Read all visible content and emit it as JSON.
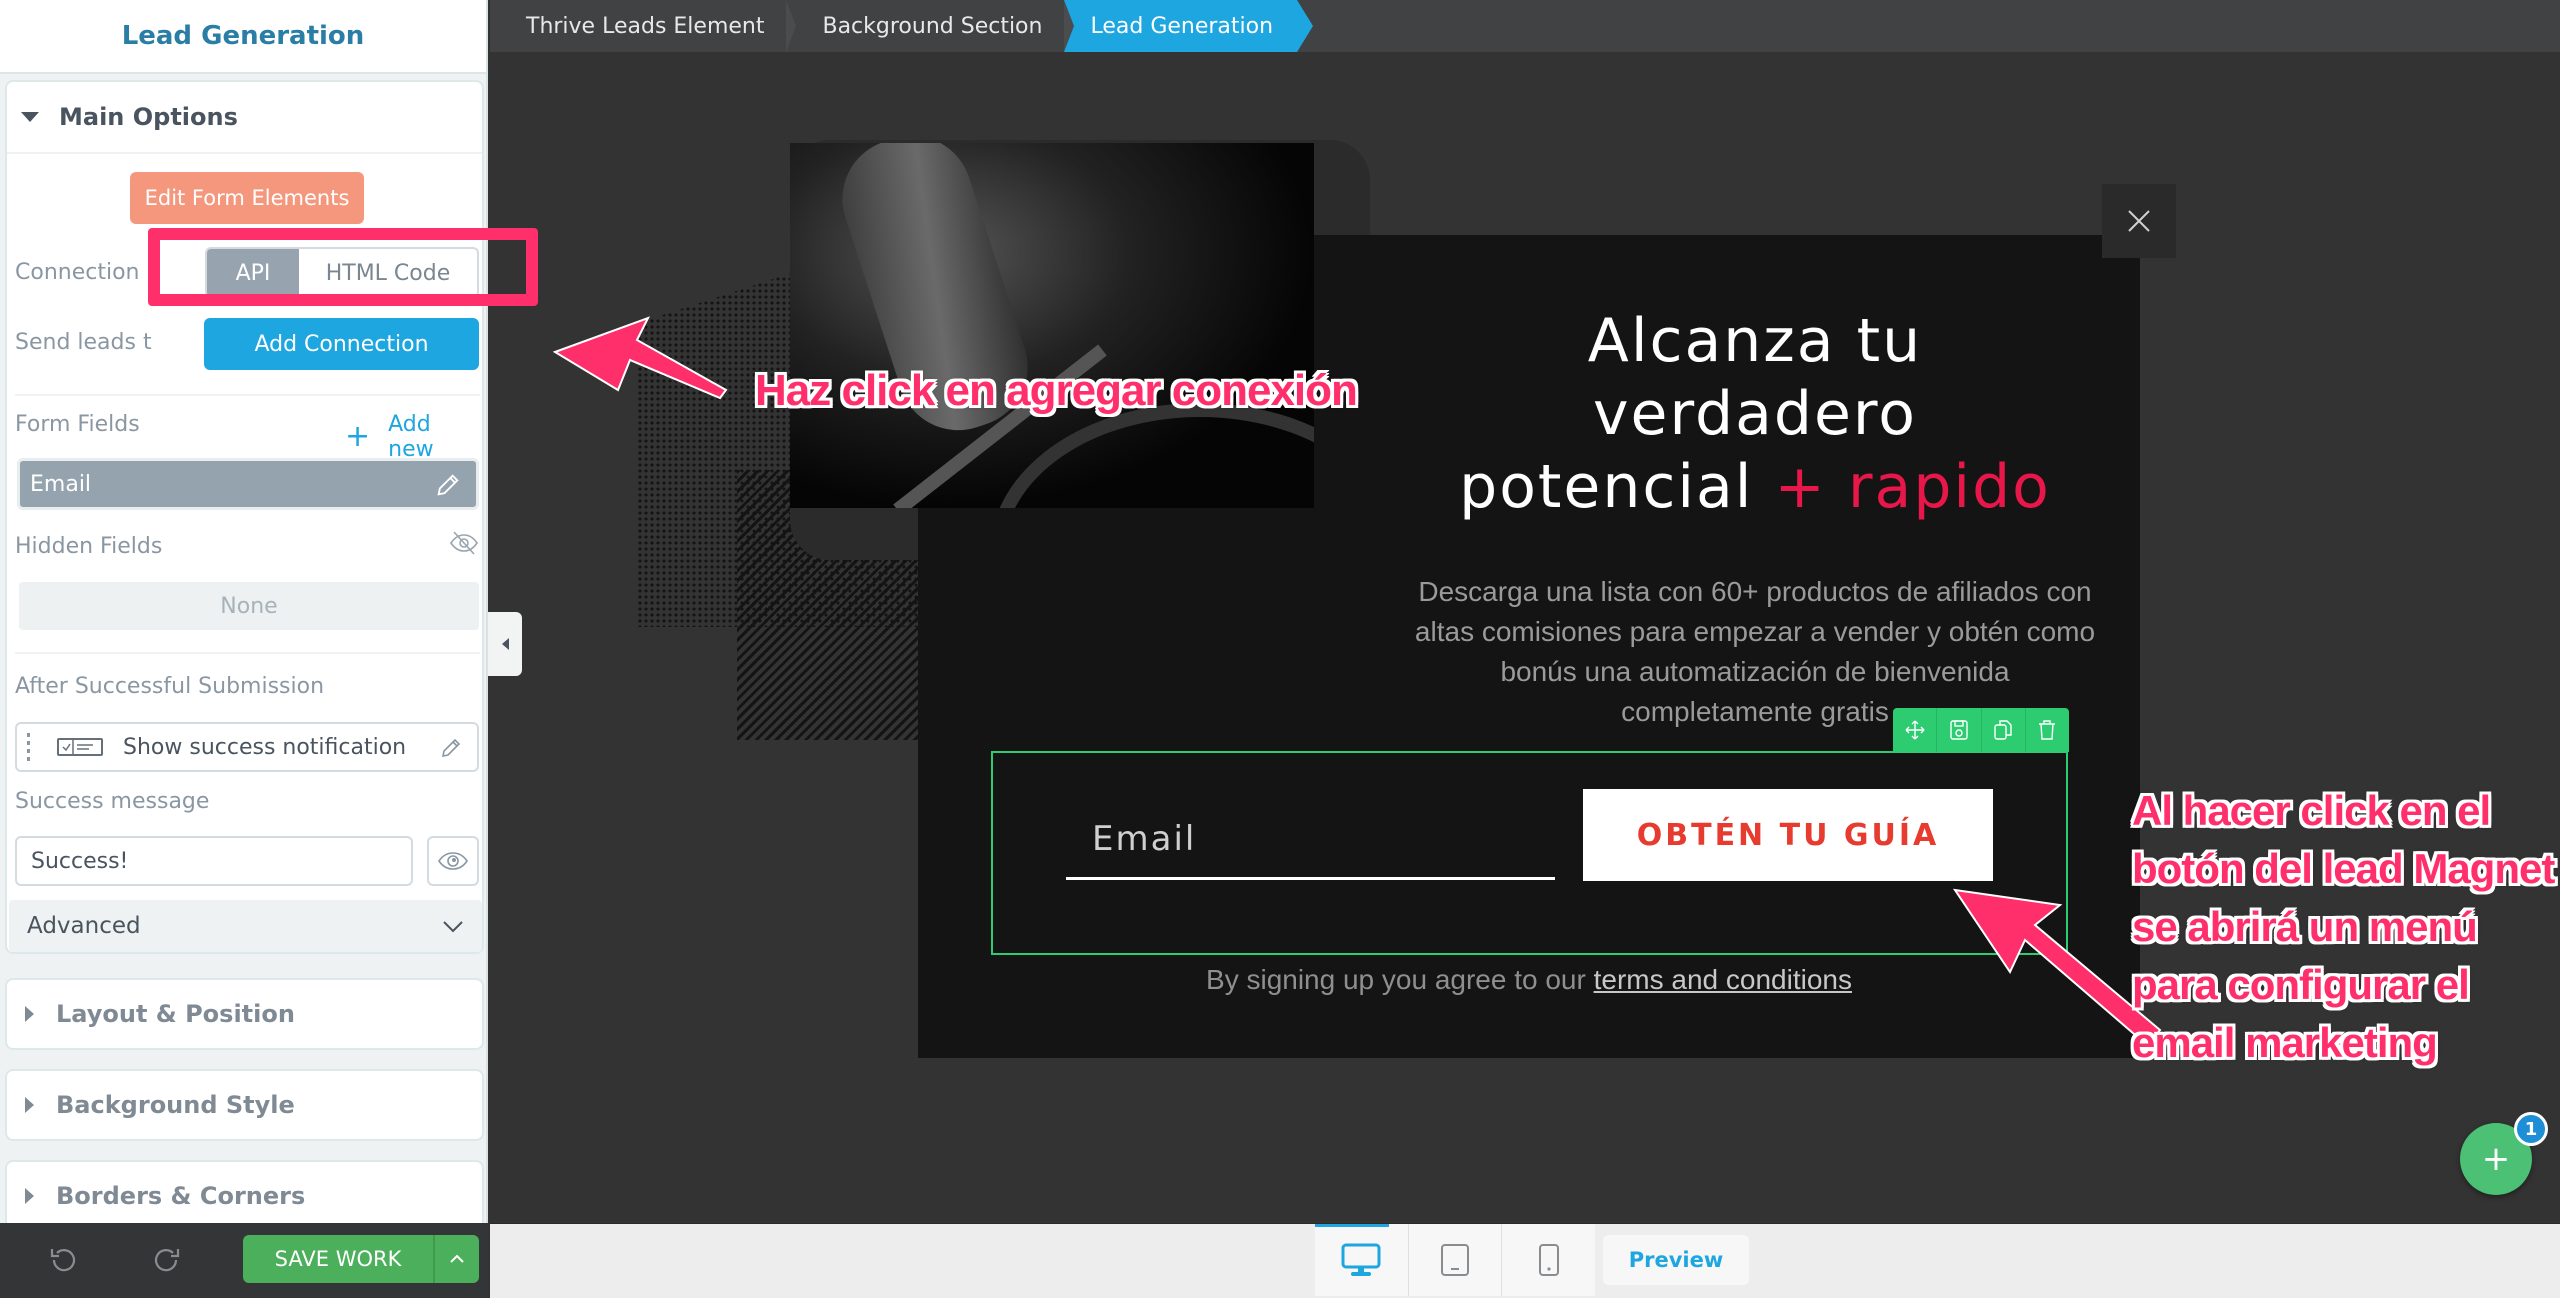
{
  "sidebar": {
    "title": "Lead Generation",
    "main_options": {
      "header": "Main Options",
      "edit_form_button": "Edit Form Elements",
      "connection_label": "Connection",
      "connection_options": [
        "API",
        "HTML Code"
      ],
      "connection_selected": "API",
      "send_leads_label": "Send leads t",
      "add_connection_button": "Add Connection",
      "form_fields_label": "Form Fields",
      "add_new_label": "Add new",
      "form_fields": [
        "Email"
      ],
      "hidden_fields_label": "Hidden Fields",
      "hidden_fields_value": "None",
      "after_submission_label": "After Successful Submission",
      "after_submission_action": "Show success notification",
      "success_message_label": "Success message",
      "success_message_value": "Success!",
      "advanced_label": "Advanced"
    },
    "sections": [
      "Layout & Position",
      "Background Style",
      "Borders & Corners"
    ],
    "footer": {
      "save_label": "SAVE WORK"
    }
  },
  "breadcrumbs": [
    "Thrive Leads Element",
    "Background Section",
    "Lead Generation"
  ],
  "popup": {
    "headline_line1": "Alcanza tu",
    "headline_line2": "verdadero",
    "headline_line3_main": "potencial ",
    "headline_line3_accent": "+ rapido",
    "description": "Descarga una lista con 60+ productos de afiliados con altas comisiones para empezar a vender y obtén como bonús una automatización de bienvenida completamente gratis",
    "email_placeholder": "Email",
    "cta_button": "OBTÉN TU GUÍA",
    "terms_prefix": "By signing up you agree to our ",
    "terms_link": "terms and conditions"
  },
  "annotations": {
    "add_connection_hint": "Haz click en agregar conexión",
    "lead_magnet_hint": "Al hacer click en el botón del lead Magnet se abrirá un menú para configurar el email marketing"
  },
  "fab": {
    "label": "+",
    "badge_count": "1"
  },
  "device_bar": {
    "devices": [
      "desktop",
      "tablet",
      "mobile"
    ],
    "active_device": "desktop",
    "preview_label": "Preview"
  },
  "colors": {
    "accent_blue": "#1da6e0",
    "save_green": "#4caf5c",
    "edit_form_orange": "#f5977c",
    "annotation_pink": "#ff2f6b",
    "headline_accent": "#e8174a",
    "cta_text_red": "#e63b2e",
    "selection_green": "#2ecc71"
  }
}
